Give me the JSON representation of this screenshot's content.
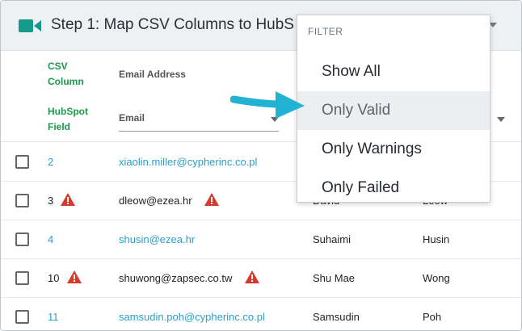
{
  "header": {
    "title": "Step 1: Map CSV Columns to HubS",
    "icon": "video-camera-icon",
    "accent": "#169a8c"
  },
  "mapping": {
    "csv_column_label": "CSV Column",
    "hubspot_field_label": "HubSpot Field",
    "column_header": "Email Address",
    "field_value": "Email"
  },
  "filter_menu": {
    "header": "FILTER",
    "options": [
      {
        "label": "Show All"
      },
      {
        "label": "Only Valid",
        "selected": true
      },
      {
        "label": "Only Warnings"
      },
      {
        "label": "Only Failed"
      }
    ]
  },
  "rows": [
    {
      "num": "2",
      "email": "xiaolin.miller@cypherinc.co.pl",
      "first": "",
      "last": "",
      "warning": false
    },
    {
      "num": "3",
      "email": "dleow@ezea.hr",
      "first": "David",
      "last": "Leow",
      "warning": true
    },
    {
      "num": "4",
      "email": "shusin@ezea.hr",
      "first": "Suhaimi",
      "last": "Husin",
      "warning": false
    },
    {
      "num": "10",
      "email": "shuwong@zapsec.co.tw",
      "first": "Shu Mae",
      "last": "Wong",
      "warning": true
    },
    {
      "num": "11",
      "email": "samsudin.poh@cypherinc.co.pl",
      "first": "Samsudin",
      "last": "Poh",
      "warning": false
    }
  ],
  "colors": {
    "link": "#2aa0c8",
    "green_label": "#1b9a4a",
    "warning": "#d9392b",
    "arrow": "#22b2d4"
  }
}
